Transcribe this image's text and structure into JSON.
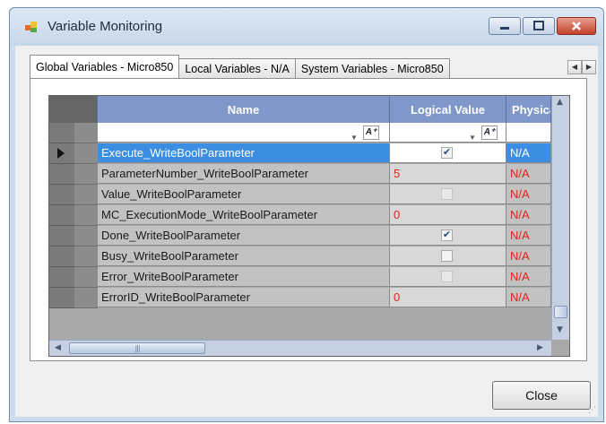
{
  "window": {
    "title": "Variable Monitoring",
    "icon": "app-variables-icon"
  },
  "tabs": [
    {
      "label": "Global Variables - Micro850",
      "active": true
    },
    {
      "label": "Local Variables - N/A",
      "active": false
    },
    {
      "label": "System Variables - Micro850",
      "active": false
    }
  ],
  "grid": {
    "columns": {
      "name": "Name",
      "logical": "Logical Value",
      "physical": "Physical"
    },
    "rows": [
      {
        "name": "Execute_WriteBoolParameter",
        "logical_text": "",
        "checkbox": "checked-dim",
        "physical": "N/A",
        "selected": true
      },
      {
        "name": "ParameterNumber_WriteBoolParameter",
        "logical_text": "5",
        "checkbox": "none",
        "physical": "N/A",
        "selected": false
      },
      {
        "name": "Value_WriteBoolParameter",
        "logical_text": "",
        "checkbox": "unchecked-dim",
        "physical": "N/A",
        "selected": false
      },
      {
        "name": "MC_ExecutionMode_WriteBoolParameter",
        "logical_text": "0",
        "checkbox": "none",
        "physical": "N/A",
        "selected": false
      },
      {
        "name": "Done_WriteBoolParameter",
        "logical_text": "",
        "checkbox": "checked",
        "physical": "N/A",
        "selected": false
      },
      {
        "name": "Busy_WriteBoolParameter",
        "logical_text": "",
        "checkbox": "unchecked",
        "physical": "N/A",
        "selected": false
      },
      {
        "name": "Error_WriteBoolParameter",
        "logical_text": "",
        "checkbox": "unchecked-dim",
        "physical": "N/A",
        "selected": false
      },
      {
        "name": "ErrorID_WriteBoolParameter",
        "logical_text": "0",
        "checkbox": "none",
        "physical": "N/A",
        "selected": false
      }
    ]
  },
  "buttons": {
    "close": "Close"
  },
  "colors": {
    "header": "#7f98c9",
    "selection": "#3b8ee2",
    "value_text": "#e2231a",
    "close_button_red": "#c2412b"
  }
}
